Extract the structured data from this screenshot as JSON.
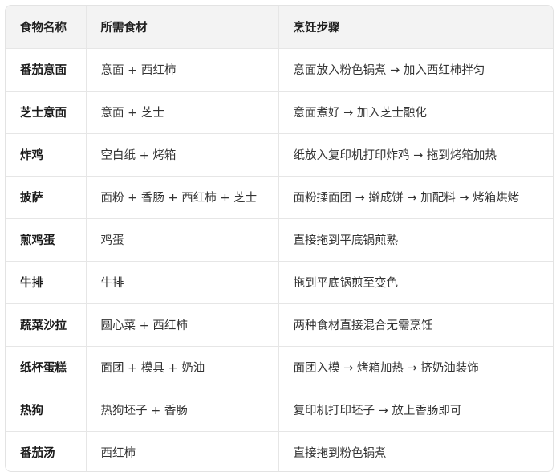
{
  "table": {
    "headers": [
      "食物名称",
      "所需食材",
      "烹饪步骤"
    ],
    "rows": [
      {
        "name": "番茄意面",
        "ingredients": "意面 + 西红柿",
        "steps": "意面放入粉色锅煮 → 加入西红柿拌匀"
      },
      {
        "name": "芝士意面",
        "ingredients": "意面 + 芝士",
        "steps": "意面煮好 → 加入芝士融化"
      },
      {
        "name": "炸鸡",
        "ingredients": "空白纸 + 烤箱",
        "steps": "纸放入复印机打印炸鸡 → 拖到烤箱加热"
      },
      {
        "name": "披萨",
        "ingredients": "面粉 + 香肠 + 西红柿 + 芝士",
        "steps": "面粉揉面团 → 擀成饼 → 加配料 → 烤箱烘烤"
      },
      {
        "name": "煎鸡蛋",
        "ingredients": "鸡蛋",
        "steps": "直接拖到平底锅煎熟"
      },
      {
        "name": "牛排",
        "ingredients": "牛排",
        "steps": "拖到平底锅煎至变色"
      },
      {
        "name": "蔬菜沙拉",
        "ingredients": "圆心菜 + 西红柿",
        "steps": "两种食材直接混合无需烹饪"
      },
      {
        "name": "纸杯蛋糕",
        "ingredients": "面团 + 模具 + 奶油",
        "steps": "面团入模 → 烤箱加热 → 挤奶油装饰"
      },
      {
        "name": "热狗",
        "ingredients": "热狗坯子 + 香肠",
        "steps": "复印机打印坯子 → 放上香肠即可"
      },
      {
        "name": "番茄汤",
        "ingredients": "西红柿",
        "steps": "直接拖到粉色锅煮"
      }
    ]
  }
}
